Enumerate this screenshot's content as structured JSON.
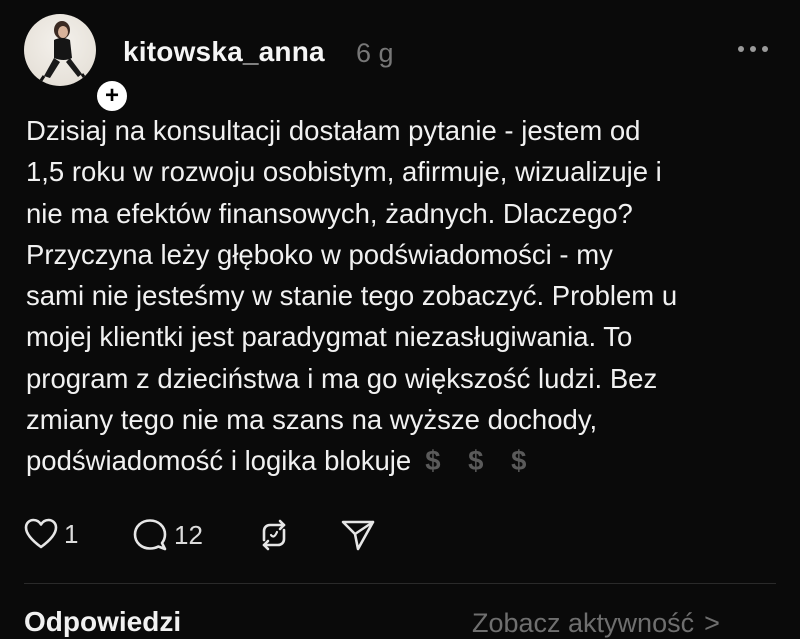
{
  "post": {
    "username": "kitowska_anna",
    "time": "6 g",
    "text": "Dzisiaj na konsultacji dostałam pytanie - jestem od\n1,5 roku w rozwoju osobistym, afirmuje, wizualizuje i\nnie ma efektów finansowych, żadnych. Dlaczego?\nPrzyczyna leży głęboko w podświadomości - my\nsami nie jesteśmy w stanie tego zobaczyć. Problem u\nmojej klientki jest paradygmat niezasługiwania. To\nprogram z dzieciństwa i ma go większość ludzi. Bez\nzmiany tego nie ma szans na wyższe dochody,\npodświadomość i logika blokuje",
    "emoji": "$ $ $",
    "likes": "1",
    "comments": "12"
  },
  "footer": {
    "replies_label": "Odpowiedzi",
    "activity_label": "Zobacz aktywność",
    "chevron": ">"
  },
  "icons": {
    "avatar": "avatar-photo",
    "follow": "plus-icon",
    "more": "more-icon",
    "like": "heart-icon",
    "comment": "comment-icon",
    "repost": "repost-icon",
    "share": "share-icon"
  },
  "colors": {
    "background": "#0a0a0a",
    "text": "#f1f1f1",
    "muted": "#777777"
  }
}
